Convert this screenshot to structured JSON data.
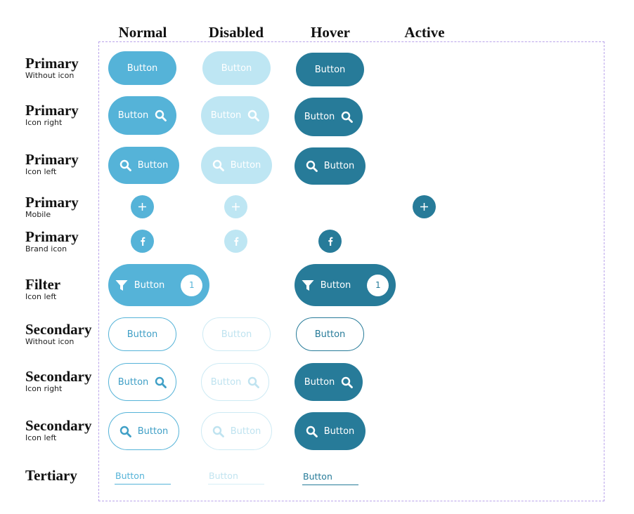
{
  "columns": [
    "Normal",
    "Disabled",
    "Hover",
    "Active"
  ],
  "rows": [
    {
      "title": "Primary",
      "subtitle": "Without icon"
    },
    {
      "title": "Primary",
      "subtitle": "Icon right"
    },
    {
      "title": "Primary",
      "subtitle": "Icon left"
    },
    {
      "title": "Primary",
      "subtitle": "Mobile"
    },
    {
      "title": "Primary",
      "subtitle": "Brand icon"
    },
    {
      "title": "Filter",
      "subtitle": "Icon left"
    },
    {
      "title": "Secondary",
      "subtitle": "Without icon"
    },
    {
      "title": "Secondary",
      "subtitle": "Icon right"
    },
    {
      "title": "Secondary",
      "subtitle": "Icon left"
    },
    {
      "title": "Tertiary",
      "subtitle": ""
    }
  ],
  "button_label": "Button",
  "filter_count": "1",
  "icons": {
    "search": "search-icon",
    "plus": "plus-icon",
    "brand": "facebook-icon",
    "filter": "filter-icon"
  },
  "colors": {
    "primary_normal": "#55b3d8",
    "primary_disabled": "#bee6f3",
    "primary_hover": "#277b99",
    "frame_border": "#b9a3ea"
  }
}
